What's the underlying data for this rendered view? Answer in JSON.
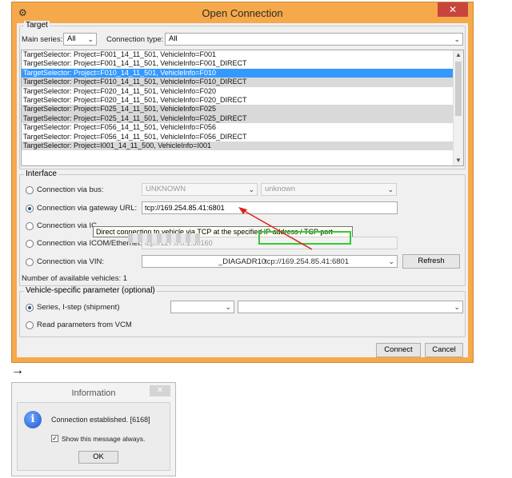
{
  "window": {
    "title": "Open Connection",
    "close": "✕",
    "app_icon": "settings-icon"
  },
  "target": {
    "group_title": "Target",
    "main_series_label": "Main series:",
    "main_series_value": "All",
    "connection_type_label": "Connection type:",
    "connection_type_value": "All",
    "rows": [
      "TargetSelector: Project=F001_14_11_501, VehicleInfo=F001",
      "TargetSelector: Project=F001_14_11_501, VehicleInfo=F001_DIRECT",
      "TargetSelector: Project=F010_14_11_501, VehicleInfo=F010",
      "TargetSelector: Project=F010_14_11_501, VehicleInfo=F010_DIRECT",
      "TargetSelector: Project=F020_14_11_501, VehicleInfo=F020",
      "TargetSelector: Project=F020_14_11_501, VehicleInfo=F020_DIRECT",
      "TargetSelector: Project=F025_14_11_501, VehicleInfo=F025",
      "TargetSelector: Project=F025_14_11_501, VehicleInfo=F025_DIRECT",
      "TargetSelector: Project=F056_14_11_501, VehicleInfo=F056",
      "TargetSelector: Project=F056_14_11_501, VehicleInfo=F056_DIRECT",
      "TargetSelector: Project=I001_14_11_500, VehicleInfo=I001"
    ]
  },
  "interface": {
    "group_title": "Interface",
    "via_bus_label": "Connection via bus:",
    "bus_value": "UNKNOWN",
    "bus_sub_value": "unknown",
    "via_gateway_label": "Connection via gateway URL:",
    "gateway_value": "tcp://169.254.85.41:6801",
    "via_icom_partial_label": "Connection via IC",
    "via_icom_eth_label": "Connection via ICOM/Ethernet:",
    "icom_eth_value": "tcp://127.0.0.1:50160",
    "via_vin_label": "Connection via VIN:",
    "vin_suffix": "_DIAGADR10",
    "vin_url": "tcp://169.254.85.41:6801",
    "refresh_label": "Refresh",
    "available_label": "Number of available vehicles: 1",
    "tooltip": "Direct connection to vehicle via TCP at the specified IP address / TCP port"
  },
  "vehicle": {
    "group_title": "Vehicle-specific parameter (optional)",
    "series_label": "Series, I-step (shipment)",
    "read_vcm_label": "Read parameters from VCM"
  },
  "buttons": {
    "connect": "Connect",
    "cancel": "Cancel"
  },
  "between_arrow": "→",
  "info": {
    "title": "Information",
    "close": "✕",
    "icon": "info-icon",
    "message": "Connection established. [6168]",
    "show_always_label": "Show this message always.",
    "ok_label": "OK"
  }
}
